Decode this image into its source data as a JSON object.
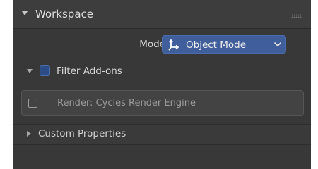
{
  "panel": {
    "title": "Workspace",
    "expanded": true,
    "header_icon": "chevron-down-icon",
    "grip_icon": "drag-grip-icon"
  },
  "mode": {
    "label": "Mode",
    "value": "Object Mode",
    "icon": "object-mode-icon",
    "dropdown_icon": "chevron-down-icon"
  },
  "filter_addons": {
    "label": "Filter Add-ons",
    "expanded": true,
    "checked": false
  },
  "addons": [
    {
      "label": "Render: Cycles Render Engine",
      "checked": false
    }
  ],
  "custom_properties": {
    "label": "Custom Properties",
    "expanded": false
  },
  "colors": {
    "panel_bg": "#383838",
    "header_bg": "#3d3d3d",
    "accent_blue": "#3f5e9b",
    "checkbox_blue": "#2c4d86",
    "text_primary": "#d4d4d4",
    "text_dim": "#9a9a9a"
  }
}
